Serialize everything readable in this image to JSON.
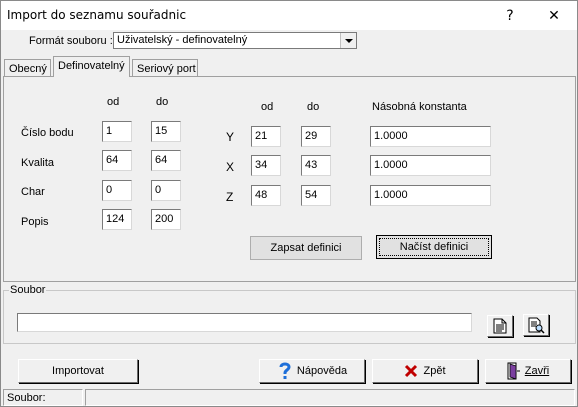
{
  "window": {
    "title": "Import do seznamu souřadnic",
    "help_glyph": "?",
    "close_glyph": "✕"
  },
  "format": {
    "label": "Formát souboru :",
    "value": "Uživatelský - definovatelný"
  },
  "tabs": [
    {
      "label": "Obecný",
      "active": false
    },
    {
      "label": "Definovatelný",
      "active": true
    },
    {
      "label": "Seriový port",
      "active": false
    }
  ],
  "left_block": {
    "header_od": "od",
    "header_do": "do",
    "rows": [
      {
        "label": "Číslo bodu",
        "od": "1",
        "do": "15"
      },
      {
        "label": "Kvalita",
        "od": "64",
        "do": "64"
      },
      {
        "label": "Char",
        "od": "0",
        "do": "0"
      },
      {
        "label": "Popis",
        "od": "124",
        "do": "200"
      }
    ]
  },
  "right_block": {
    "header_od": "od",
    "header_do": "do",
    "header_const": "Násobná konstanta",
    "rows": [
      {
        "label": "Y",
        "od": "21",
        "do": "29",
        "const": "1.0000"
      },
      {
        "label": "X",
        "od": "34",
        "do": "43",
        "const": "1.0000"
      },
      {
        "label": "Z",
        "od": "48",
        "do": "54",
        "const": "1.0000"
      }
    ]
  },
  "definition_buttons": {
    "save": "Zapsat definici",
    "load": "Načíst definici"
  },
  "file_group": {
    "title": "Soubor",
    "path_value": ""
  },
  "bottom_buttons": {
    "import": "Importovat",
    "help": "Nápověda",
    "back": "Zpět",
    "close": "Zavři"
  },
  "statusbar": {
    "file_label": "Soubor:",
    "file_value": ""
  },
  "colors": {
    "help_icon": "#1e6fd9",
    "back_icon": "#c00000",
    "close_icon_door": "#7b3fa0"
  }
}
